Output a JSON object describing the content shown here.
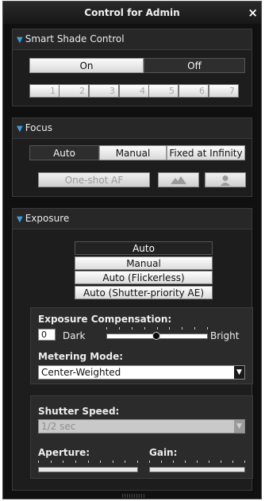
{
  "window": {
    "title": "Control for Admin",
    "close_glyph": "×"
  },
  "shade": {
    "header": "Smart Shade Control",
    "toggle": {
      "on": "On",
      "off": "Off",
      "selected": "Off"
    },
    "levels": [
      "1",
      "2",
      "3",
      "4",
      "5",
      "6",
      "7"
    ]
  },
  "focus": {
    "header": "Focus",
    "modes": [
      "Auto",
      "Manual",
      "Fixed at Infinity"
    ],
    "selected": "Auto",
    "oneshot": "One-shot AF",
    "icons": [
      "landscape-icon",
      "portrait-icon"
    ]
  },
  "exposure": {
    "header": "Exposure",
    "modes": [
      "Auto",
      "Manual",
      "Auto (Flickerless)",
      "Auto (Shutter-priority AE)"
    ],
    "selected": "Auto",
    "compensation": {
      "label": "Exposure Compensation:",
      "value": "0",
      "dark": "Dark",
      "bright": "Bright",
      "level": 0.49
    },
    "metering": {
      "label": "Metering Mode:",
      "value": "Center-Weighted"
    },
    "shutter": {
      "label": "Shutter Speed:",
      "value": "1/2 sec"
    },
    "aperture": {
      "label": "Aperture:"
    },
    "gain": {
      "label": "Gain:"
    }
  },
  "colors": {
    "accent": "#3aa0e6",
    "background": "#101010"
  }
}
